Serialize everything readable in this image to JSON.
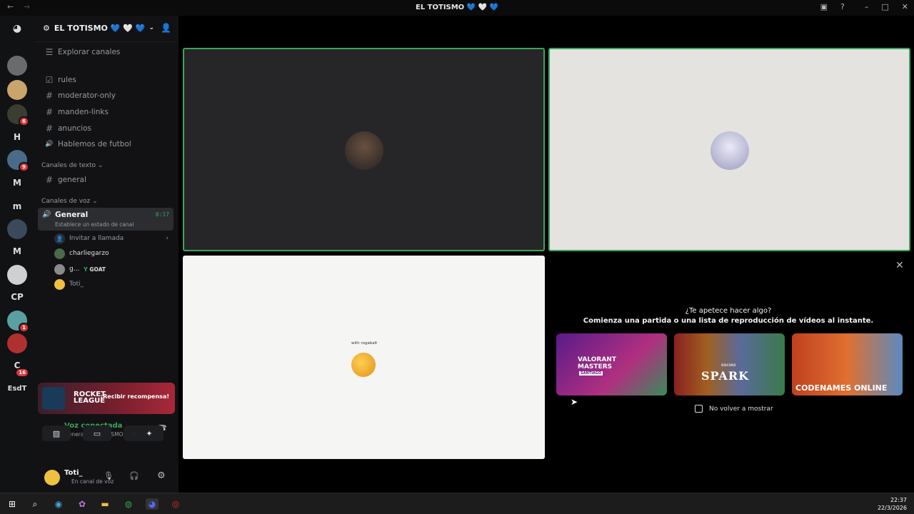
{
  "window": {
    "title": "EL TOTISMO 💙 🤍 💙"
  },
  "server": {
    "name": "EL TOTISMO 💙 🤍 💙"
  },
  "guilds": [
    {
      "label": "",
      "badge": "",
      "color": "#5865f2"
    },
    {
      "label": "",
      "badge": "",
      "color": "#6b6b6b"
    },
    {
      "label": "",
      "badge": "",
      "color": "#c9a46b"
    },
    {
      "label": "",
      "badge": "6",
      "color": "#3a3d2f"
    },
    {
      "label": "H",
      "badge": "",
      "color": "#111214"
    },
    {
      "label": "",
      "badge": "9",
      "color": "#4a6a8a"
    },
    {
      "label": "M",
      "badge": "",
      "color": "#111214"
    },
    {
      "label": "m",
      "badge": "",
      "color": "#111214"
    },
    {
      "label": "",
      "badge": "",
      "color": "#3a4a5a"
    },
    {
      "label": "M",
      "badge": "",
      "color": "#111214"
    },
    {
      "label": "",
      "badge": "",
      "color": "#d0d0d0"
    },
    {
      "label": "CP",
      "badge": "",
      "color": "#111214"
    },
    {
      "label": "",
      "badge": "1",
      "color": "#5aa0a0"
    },
    {
      "label": "",
      "badge": "",
      "color": "#b03030"
    },
    {
      "label": "C",
      "badge": "16",
      "color": "#111214"
    },
    {
      "label": "EsdT",
      "badge": "",
      "color": "#111214"
    }
  ],
  "channels": {
    "browse": "Explorar canales",
    "top": [
      {
        "icon": "☑",
        "name": "rules"
      },
      {
        "icon": "#",
        "name": "moderator-only"
      },
      {
        "icon": "#",
        "name": "manden-links"
      },
      {
        "icon": "#",
        "name": "anuncios"
      },
      {
        "icon": "🔊",
        "name": "Hablemos de futbol"
      }
    ],
    "text_category": "Canales de texto",
    "text": [
      {
        "icon": "#",
        "name": "general"
      }
    ],
    "voice_category": "Canales de voz",
    "voice": {
      "name": "General",
      "timer": "0:17",
      "status": "Establece un estado de canal",
      "invite": "Invitar a llamada",
      "users": [
        {
          "name": "charliegarzo",
          "tag": ""
        },
        {
          "name": "g...",
          "tag": "GOAT"
        },
        {
          "name": "Toti_",
          "tag": ""
        }
      ]
    }
  },
  "promo": {
    "game": "ROCKET LEAGUE",
    "button": "¡Recibir recompensa!"
  },
  "voice_connection": {
    "status": "Voz conectada",
    "location": "General / EL TOTISMO 💙 🤍 💙"
  },
  "user": {
    "name": "Toti_",
    "status": "En canal de voz"
  },
  "stage": {
    "tile_c_caption": "with rogabalt"
  },
  "activity": {
    "heading": "¿Te apetece hacer algo?",
    "subheading": "Comienza una partida o una lista de reproducción de vídeos al instante.",
    "cards": [
      {
        "title": "VALORANT MASTERS",
        "sub": "SANTIAGO"
      },
      {
        "title": "SPARK",
        "sub": "DISCORD"
      },
      {
        "title": "CODENAMES ONLINE",
        "sub": ""
      }
    ],
    "checkbox": "No volver a mostrar"
  },
  "taskbar": {
    "time": "22:37",
    "date": "22/3/2026"
  }
}
